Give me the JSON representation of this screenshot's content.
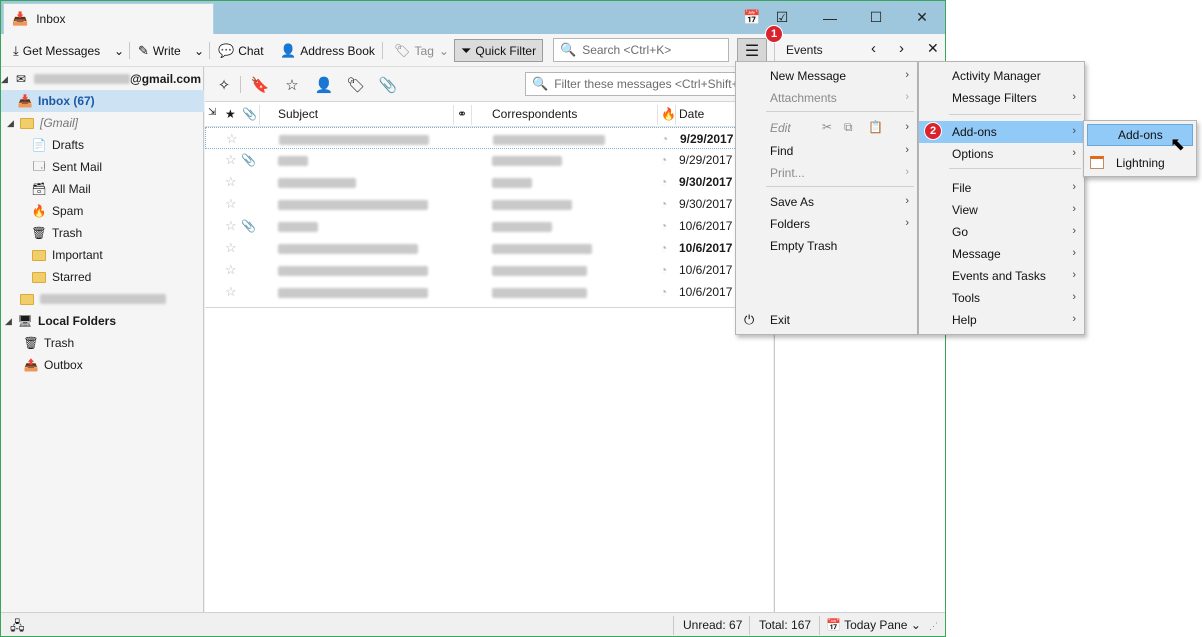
{
  "tab": {
    "title": "Inbox"
  },
  "toolbar": {
    "get_messages": "Get Messages",
    "write": "Write",
    "chat": "Chat",
    "address_book": "Address Book",
    "tag": "Tag",
    "quick_filter": "Quick Filter",
    "search_placeholder": "Search <Ctrl+K>"
  },
  "steps": {
    "one": "1",
    "two": "2"
  },
  "account": {
    "email_suffix": "@gmail.com"
  },
  "folders": {
    "inbox": "Inbox (67)",
    "gmail": "[Gmail]",
    "drafts": "Drafts",
    "sent": "Sent Mail",
    "all": "All Mail",
    "spam": "Spam",
    "trash": "Trash",
    "important": "Important",
    "starred": "Starred",
    "local": "Local Folders",
    "local_trash": "Trash",
    "outbox": "Outbox"
  },
  "filter": {
    "placeholder": "Filter these messages <Ctrl+Shift+K>"
  },
  "columns": {
    "subject": "Subject",
    "correspondents": "Correspondents",
    "date": "Date"
  },
  "messages": [
    {
      "date": "9/29/2017",
      "bold": true,
      "attachment": false
    },
    {
      "date": "9/29/2017",
      "bold": false,
      "attachment": true
    },
    {
      "date": "9/30/2017",
      "bold": true,
      "attachment": false
    },
    {
      "date": "9/30/2017",
      "bold": false,
      "attachment": false
    },
    {
      "date": "10/6/2017",
      "bold": false,
      "attachment": true
    },
    {
      "date": "10/6/2017",
      "bold": true,
      "attachment": false
    },
    {
      "date": "10/6/2017",
      "bold": false,
      "attachment": false
    },
    {
      "date": "10/6/2017",
      "bold": false,
      "attachment": false
    }
  ],
  "today_pane": {
    "title": "Events"
  },
  "status": {
    "unread": "Unread: 67",
    "total": "Total: 167",
    "today_pane": "Today Pane"
  },
  "app_menu": {
    "left": {
      "new_message": "New Message",
      "attachments": "Attachments",
      "edit": "Edit",
      "find": "Find",
      "print": "Print...",
      "save_as": "Save As",
      "folders": "Folders",
      "empty_trash": "Empty Trash",
      "exit": "Exit"
    },
    "right": {
      "activity_manager": "Activity Manager",
      "message_filters": "Message Filters",
      "addons": "Add-ons",
      "options": "Options",
      "file": "File",
      "view": "View",
      "go": "Go",
      "message": "Message",
      "events_tasks": "Events and Tasks",
      "tools": "Tools",
      "help": "Help"
    },
    "submenu": {
      "addons": "Add-ons",
      "lightning": "Lightning"
    }
  }
}
